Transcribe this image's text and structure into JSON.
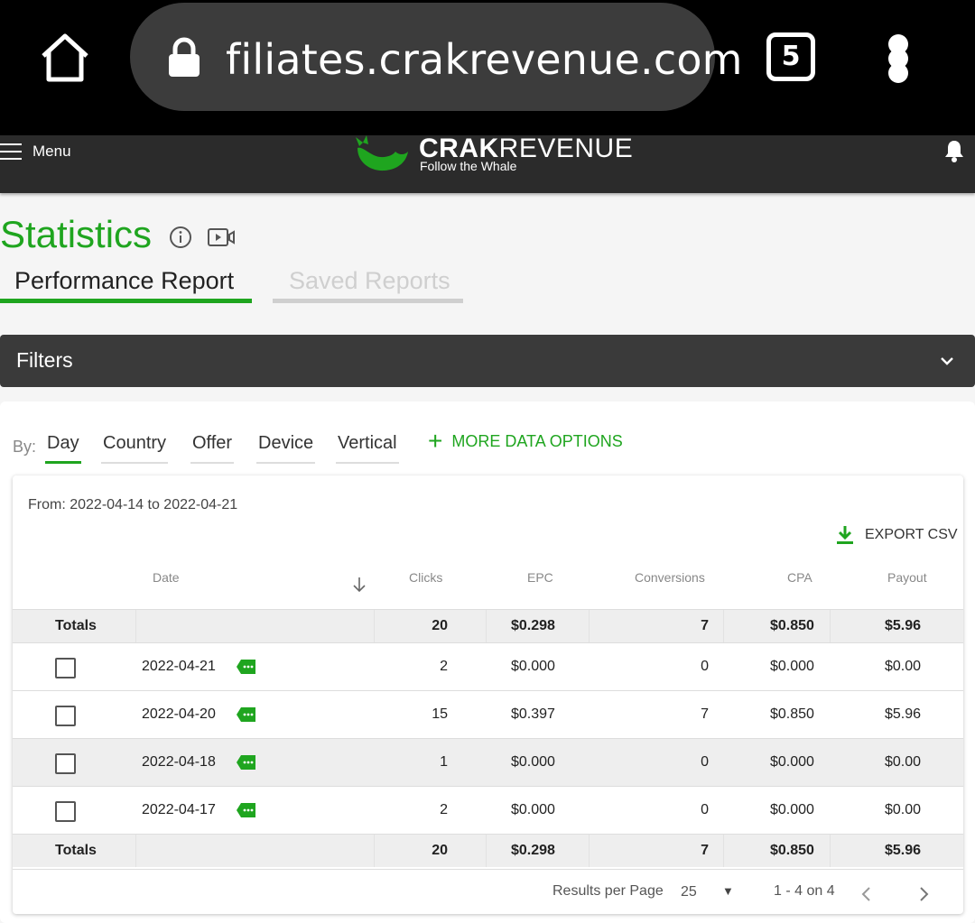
{
  "browser": {
    "url": "filiates.crakrevenue.com",
    "tab_count": "5"
  },
  "header": {
    "menu_label": "Menu",
    "brand_bold": "CRAK",
    "brand_light": "REVENUE",
    "brand_tagline": "Follow the Whale"
  },
  "page": {
    "title": "Statistics",
    "tabs": [
      {
        "label": "Performance Report",
        "active": true
      },
      {
        "label": "Saved Reports",
        "active": false
      }
    ],
    "filters_label": "Filters"
  },
  "group_by": {
    "label": "By:",
    "options": [
      "Day",
      "Country",
      "Offer",
      "Device",
      "Vertical"
    ],
    "active": "Day",
    "more_label": "MORE DATA OPTIONS"
  },
  "report": {
    "date_range": "From: 2022-04-14 to 2022-04-21",
    "export_label": "EXPORT CSV",
    "columns": {
      "date": "Date",
      "clicks": "Clicks",
      "epc": "EPC",
      "conversions": "Conversions",
      "cpa": "CPA",
      "payout": "Payout"
    },
    "totals": {
      "label": "Totals",
      "clicks": "20",
      "epc": "$0.298",
      "conversions": "7",
      "cpa": "$0.850",
      "payout": "$5.96"
    },
    "rows": [
      {
        "date": "2022-04-21",
        "clicks": "2",
        "epc": "$0.000",
        "conversions": "0",
        "cpa": "$0.000",
        "payout": "$0.00"
      },
      {
        "date": "2022-04-20",
        "clicks": "15",
        "epc": "$0.397",
        "conversions": "7",
        "cpa": "$0.850",
        "payout": "$5.96"
      },
      {
        "date": "2022-04-18",
        "clicks": "1",
        "epc": "$0.000",
        "conversions": "0",
        "cpa": "$0.000",
        "payout": "$0.00"
      },
      {
        "date": "2022-04-17",
        "clicks": "2",
        "epc": "$0.000",
        "conversions": "0",
        "cpa": "$0.000",
        "payout": "$0.00"
      }
    ],
    "pagination": {
      "results_label": "Results per Page",
      "results_value": "25",
      "range": "1 - 4 on 4"
    }
  },
  "colors": {
    "brand_green": "#1fa51f",
    "header_dark": "#2b2b2b",
    "filters_bar": "#3a3a3a"
  }
}
